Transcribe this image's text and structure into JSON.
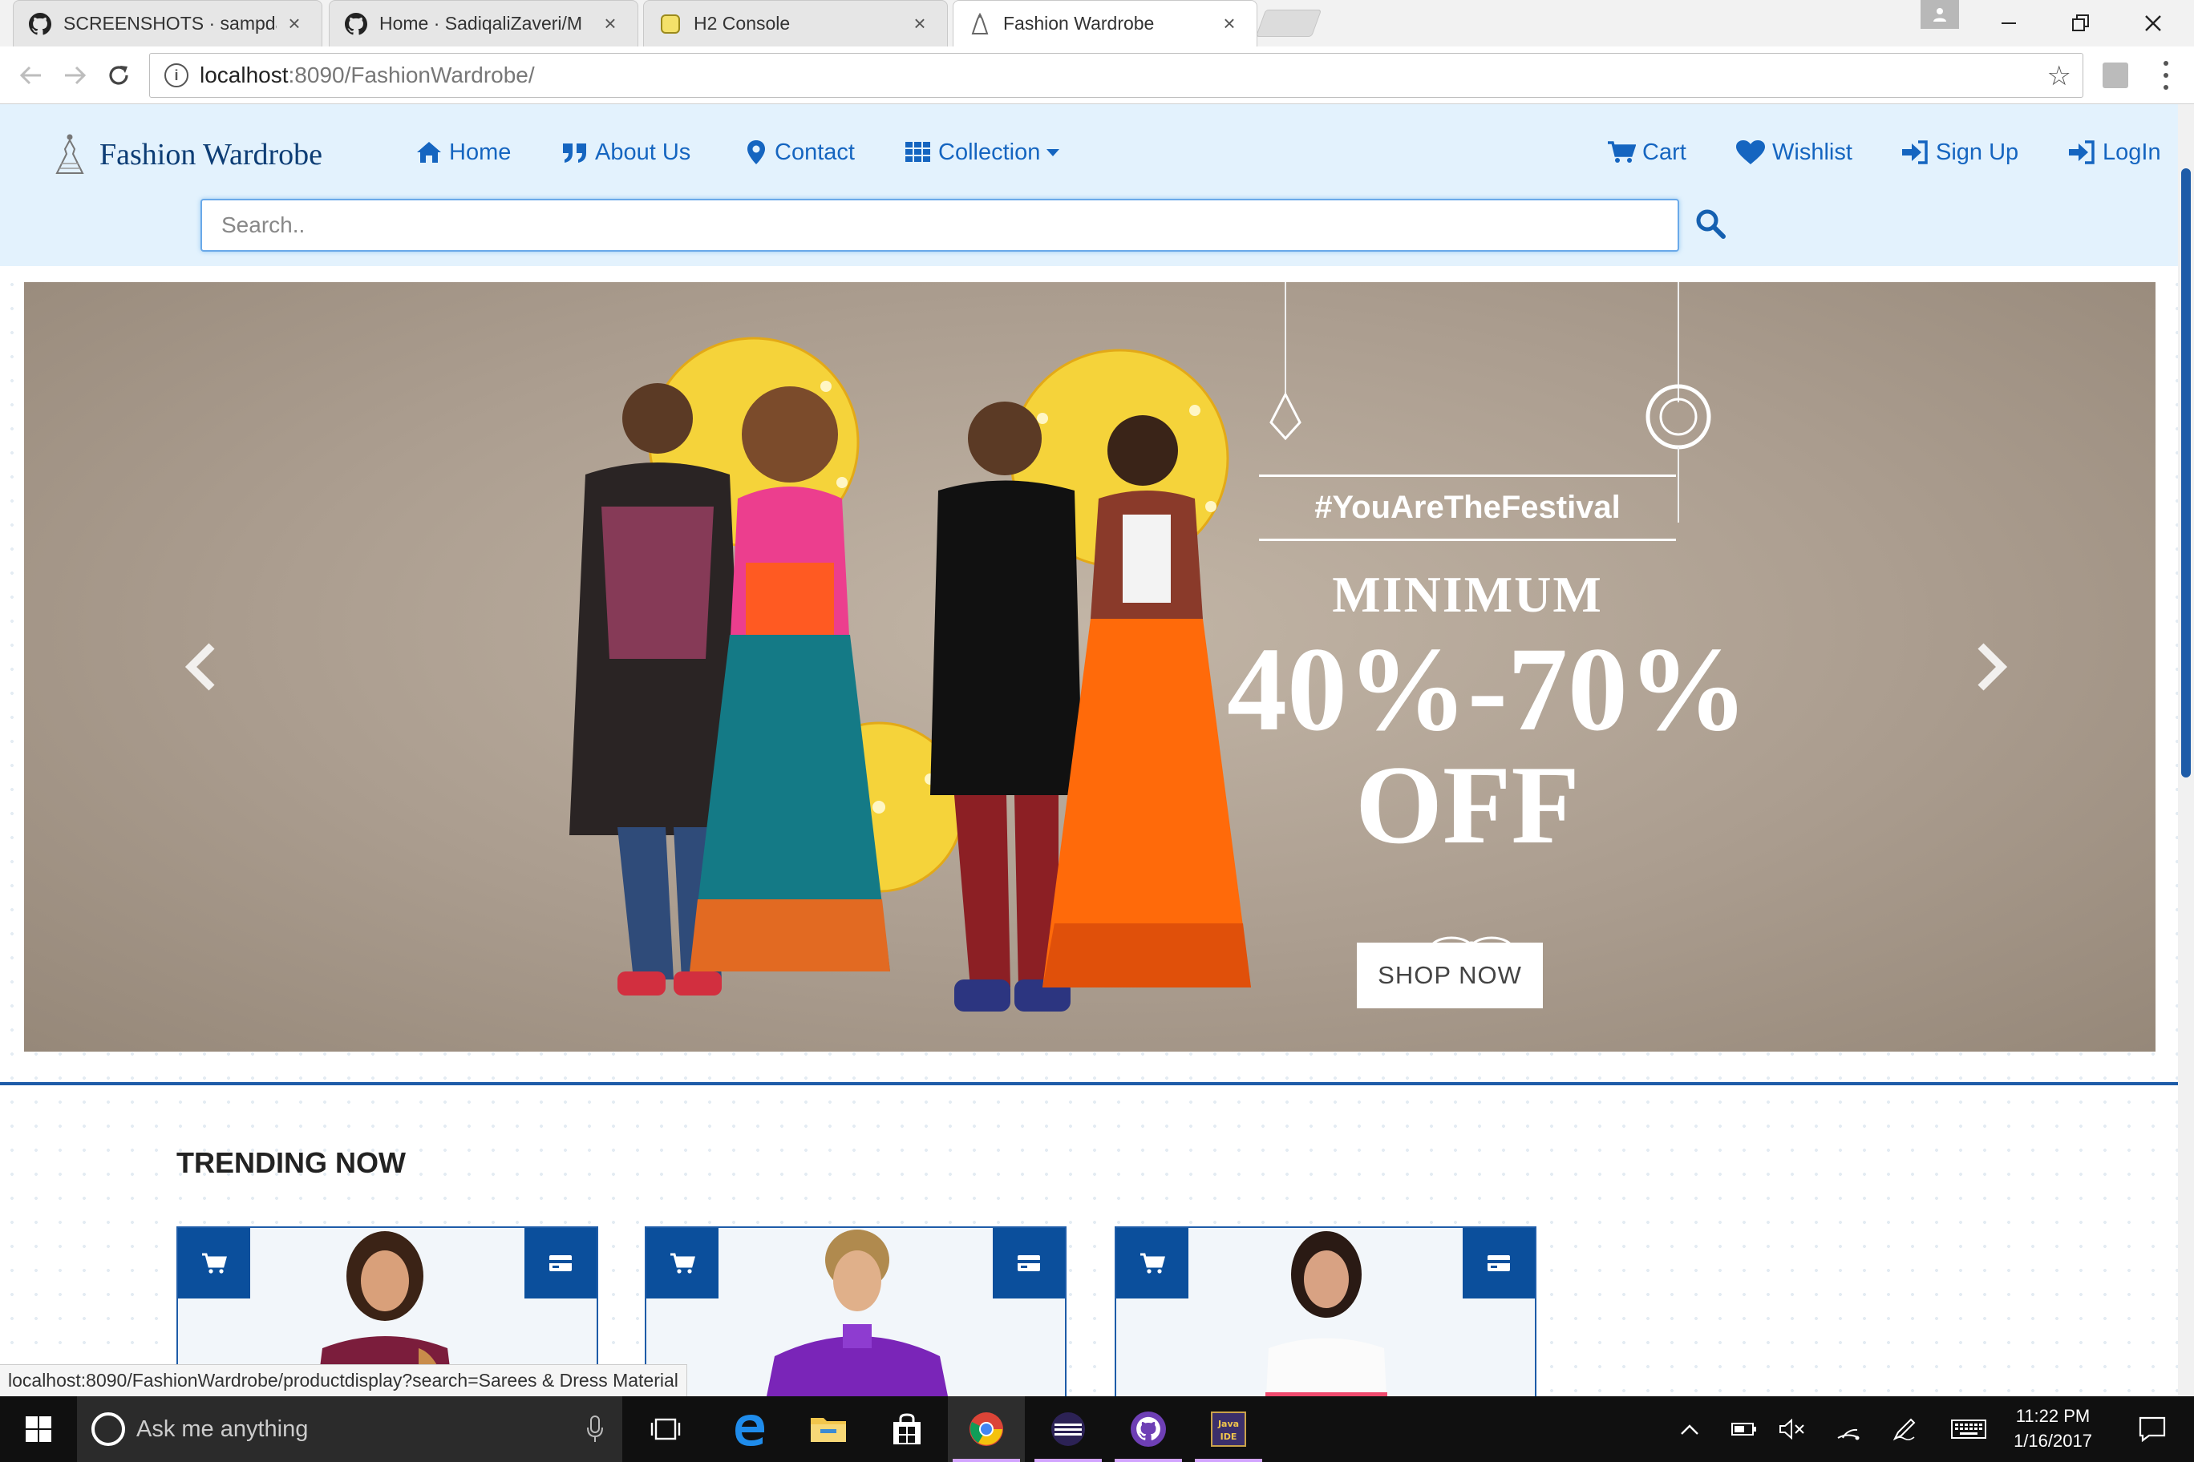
{
  "browser": {
    "tabs": [
      {
        "title": "SCREENSHOTS · sampda",
        "icon": "github-icon",
        "active": false
      },
      {
        "title": "Home · SadiqaliZaveri/M",
        "icon": "github-icon",
        "active": false
      },
      {
        "title": "H2 Console",
        "icon": "h2-icon",
        "active": false
      },
      {
        "title": "Fashion Wardrobe",
        "icon": "fashion-icon",
        "active": true
      }
    ],
    "close_glyph": "×",
    "url_host": "localhost",
    "url_rest": ":8090/FashionWardrobe/"
  },
  "site": {
    "brand": "Fashion Wardrobe",
    "nav": {
      "home": "Home",
      "about": "About Us",
      "contact": "Contact",
      "collection": "Collection",
      "cart": "Cart",
      "wishlist": "Wishlist",
      "signup": "Sign Up",
      "login": "LogIn"
    },
    "search": {
      "placeholder": "Search..",
      "value": ""
    },
    "banner": {
      "hashtag": "#YouAreTheFestival",
      "line1": "MINIMUM",
      "line2": "40%-70%",
      "line3": "OFF",
      "cta": "SHOP NOW",
      "slide_count": 4,
      "active_slide": 1
    },
    "trending_title": "TRENDING NOW",
    "accent": "#0b4f9c",
    "header_bg": "#e3f2fd"
  },
  "status_url": "localhost:8090/FashionWardrobe/productdisplay?search=Sarees & Dress  Material",
  "taskbar": {
    "search_placeholder": "Ask me anything",
    "time": "11:22 PM",
    "date": "1/16/2017"
  }
}
